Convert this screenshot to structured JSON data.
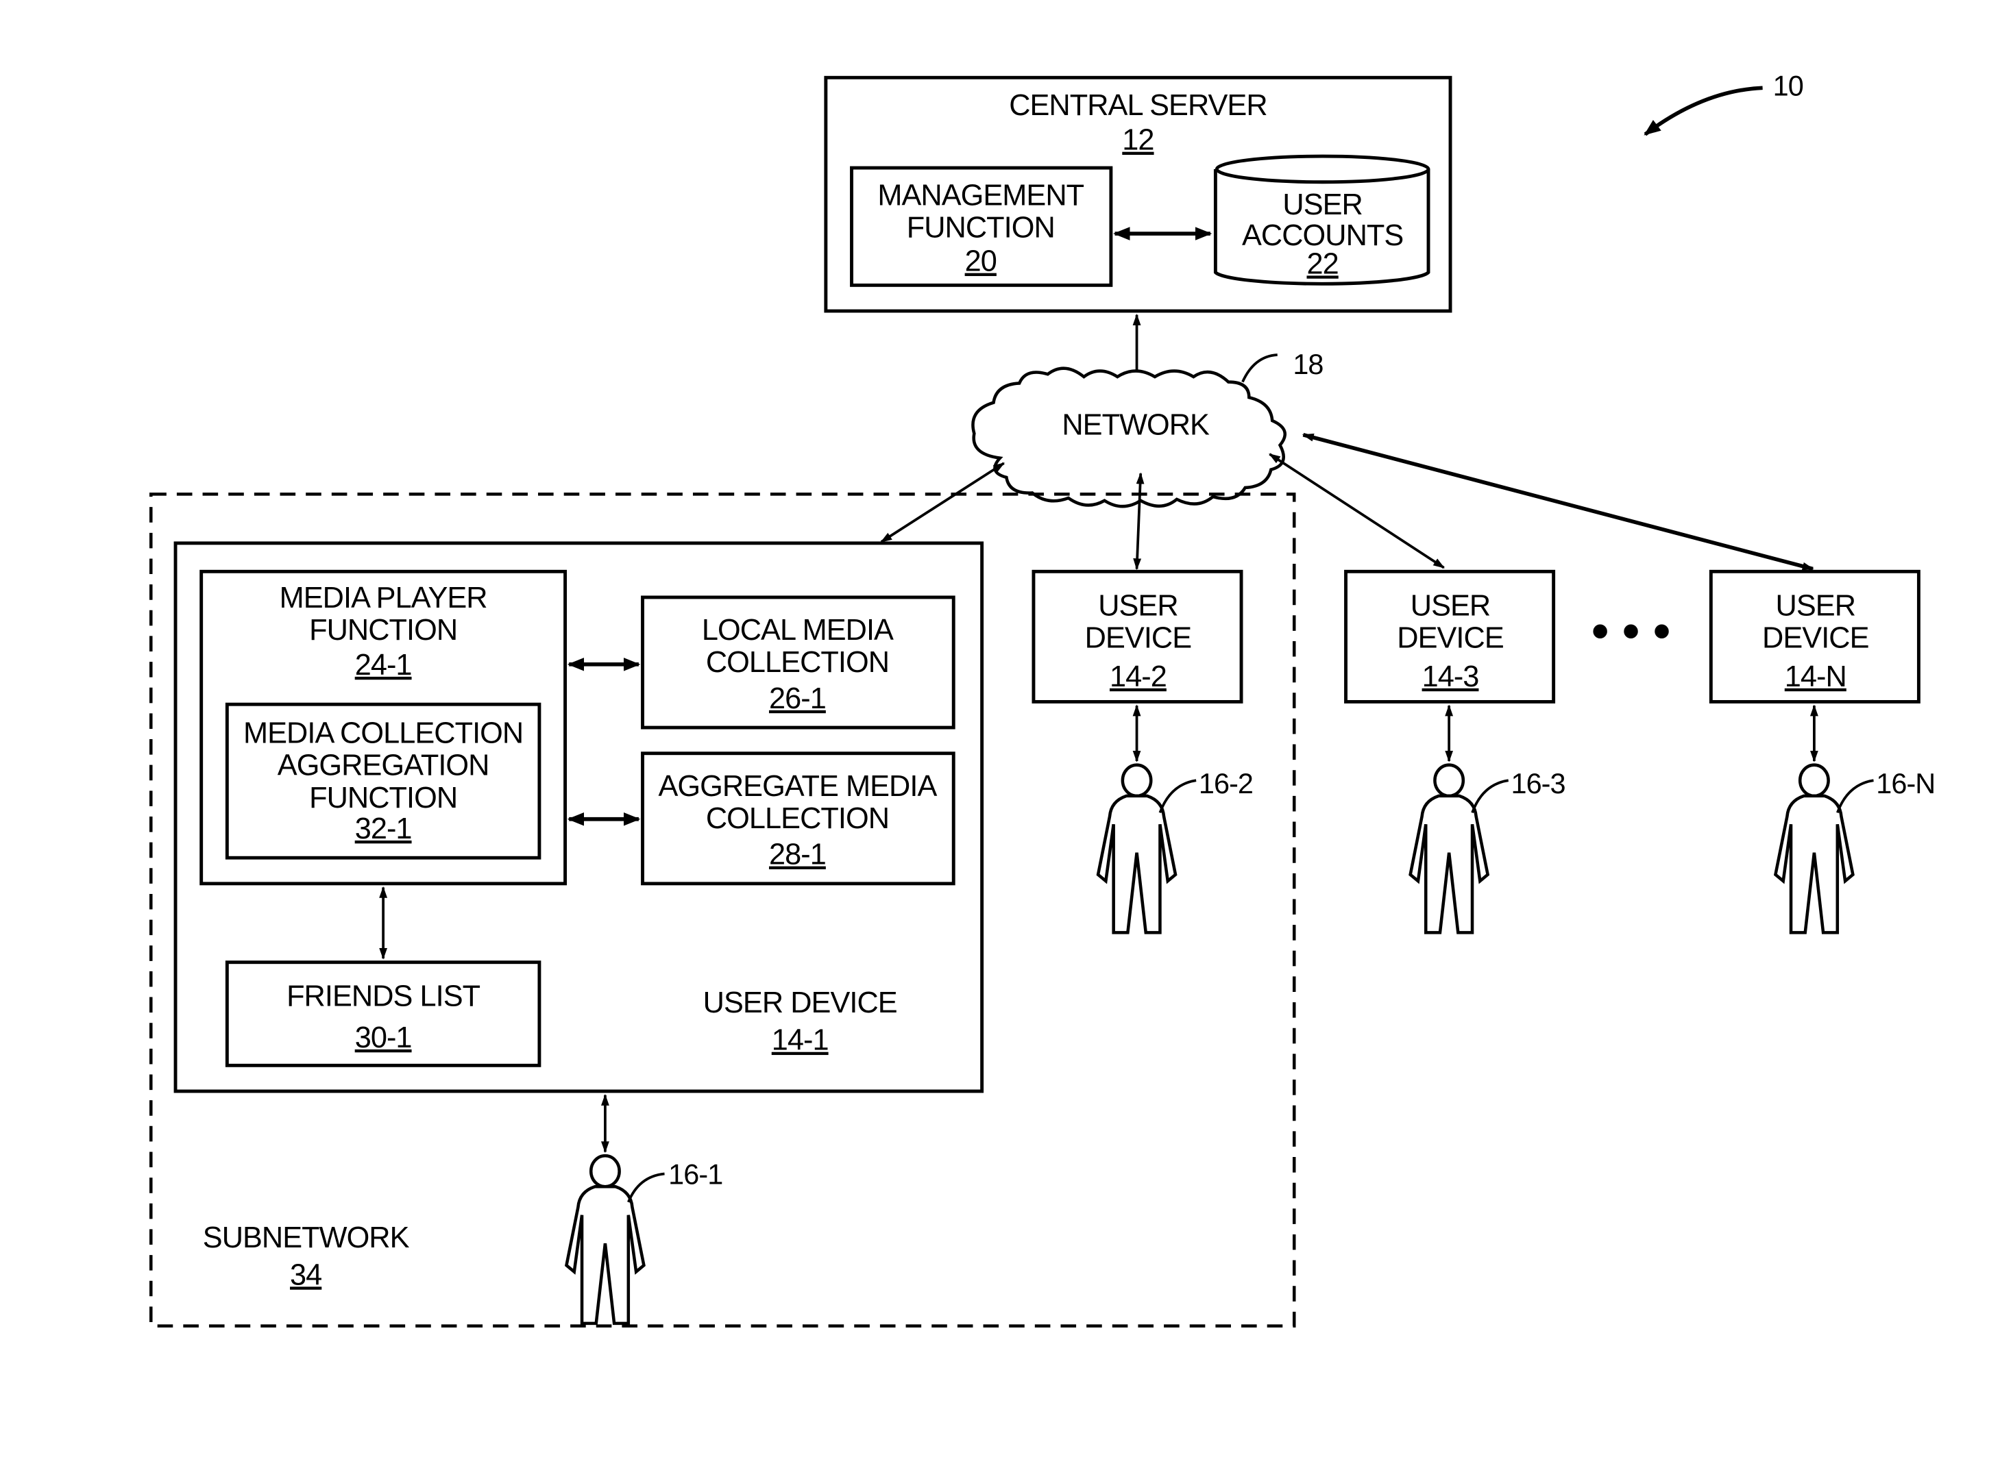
{
  "figure": {
    "ref": "10"
  },
  "central_server": {
    "title": "CENTRAL SERVER",
    "ref": "12",
    "management_function": {
      "line1": "MANAGEMENT",
      "line2": "FUNCTION",
      "ref": "20"
    },
    "user_accounts": {
      "line1": "USER",
      "line2": "ACCOUNTS",
      "ref": "22"
    }
  },
  "network": {
    "label": "NETWORK",
    "ref": "18"
  },
  "subnetwork": {
    "label": "SUBNETWORK",
    "ref": "34"
  },
  "user_device_1": {
    "label": "USER DEVICE",
    "ref": "14-1",
    "media_player_function": {
      "line1": "MEDIA PLAYER",
      "line2": "FUNCTION",
      "ref": "24-1"
    },
    "aggregation_function": {
      "line1": "MEDIA COLLECTION",
      "line2": "AGGREGATION",
      "line3": "FUNCTION",
      "ref": "32-1"
    },
    "local_media_collection": {
      "line1": "LOCAL MEDIA",
      "line2": "COLLECTION",
      "ref": "26-1"
    },
    "aggregate_media_collection": {
      "line1": "AGGREGATE MEDIA",
      "line2": "COLLECTION",
      "ref": "28-1"
    },
    "friends_list": {
      "label": "FRIENDS LIST",
      "ref": "30-1"
    }
  },
  "other_devices": [
    {
      "line1": "USER",
      "line2": "DEVICE",
      "ref": "14-2",
      "user_ref": "16-2"
    },
    {
      "line1": "USER",
      "line2": "DEVICE",
      "ref": "14-3",
      "user_ref": "16-3"
    },
    {
      "line1": "USER",
      "line2": "DEVICE",
      "ref": "14-N",
      "user_ref": "16-N"
    }
  ],
  "user_1": {
    "ref": "16-1"
  },
  "ellipsis": "• • •"
}
